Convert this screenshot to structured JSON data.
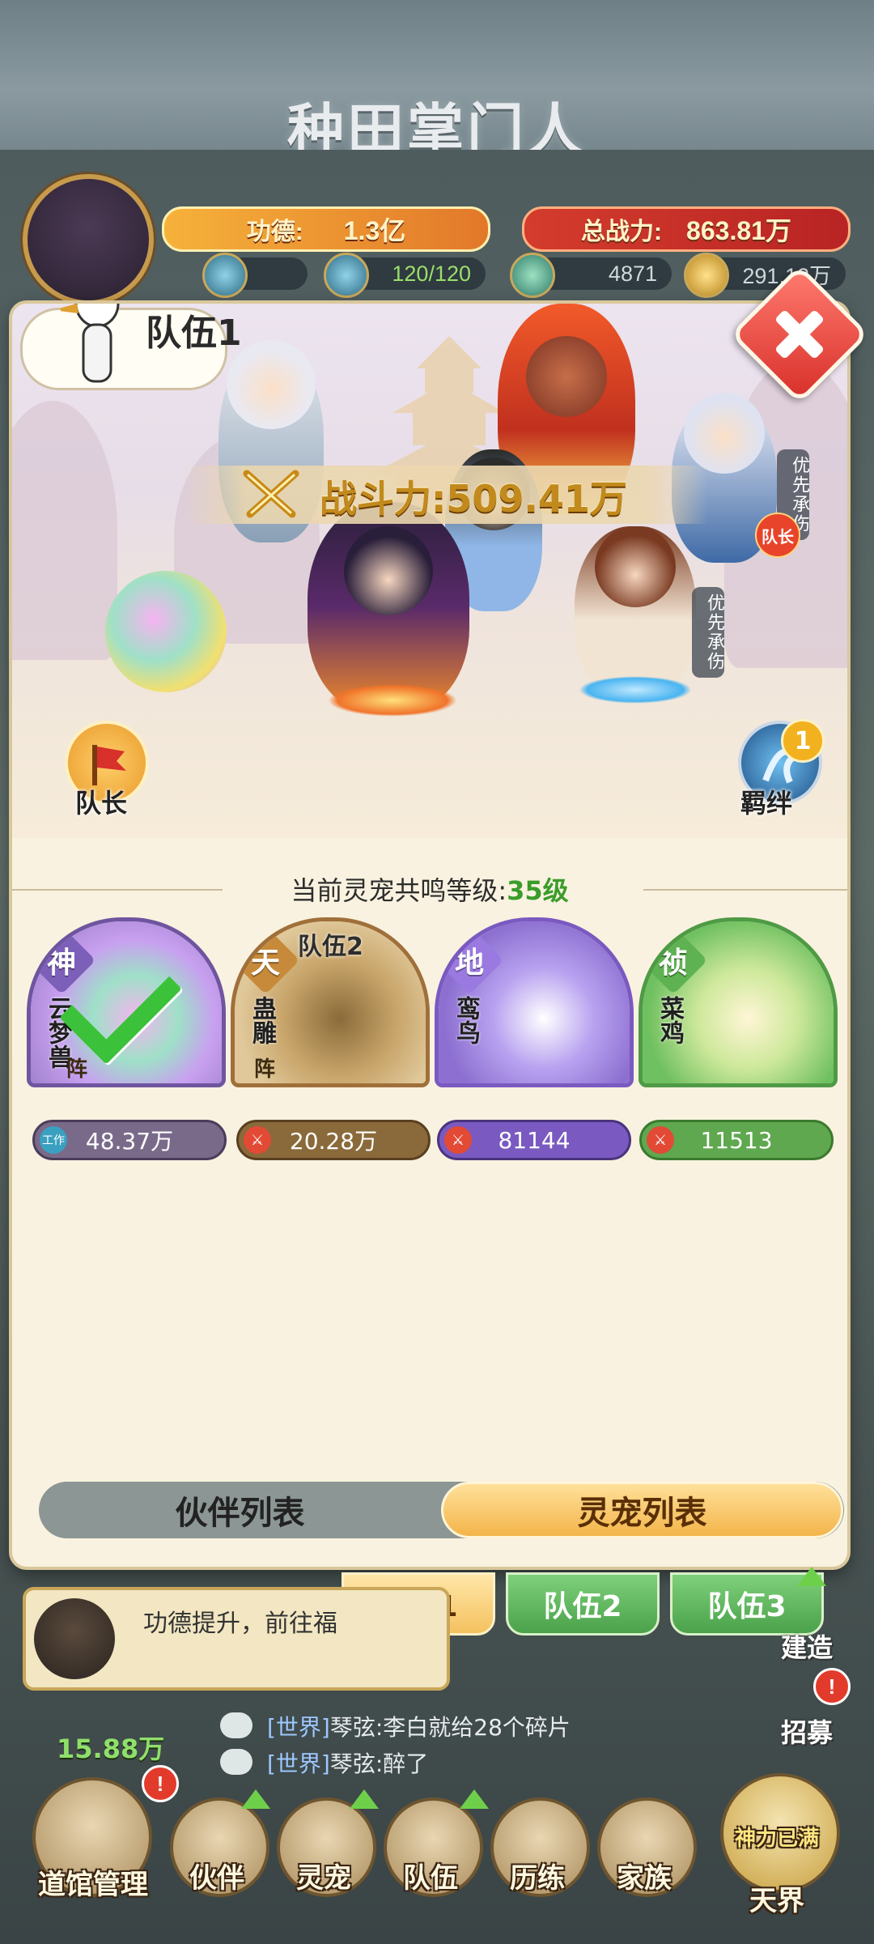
{
  "game": {
    "title": "种田掌门人",
    "merit_label": "功德:",
    "merit_value": "1.3亿",
    "total_power_label": "总战力:",
    "total_power_value": "863.81万",
    "stamina": "120/120",
    "resource_a": "4871",
    "resource_b": "291.12万"
  },
  "dialog": {
    "team_title": "队伍1",
    "leader_button": "队长",
    "bond_button": "羁绊",
    "bond_badge": "1",
    "power_label": "战斗力:",
    "power_value": "509.41万",
    "tag_priority_1": "优先承伤",
    "tag_priority_2": "优先承伤",
    "leader_badge": "队长",
    "resonance_label": "当前灵宠共鸣等级:",
    "resonance_level": "35级"
  },
  "pets": [
    {
      "rank": "神",
      "name": "云梦兽",
      "team": "",
      "formation": "阵",
      "status": "工作",
      "power": "48.37万",
      "selected": true,
      "color": "#8a6fb8"
    },
    {
      "rank": "天",
      "name": "蛊雕",
      "team": "队伍2",
      "formation": "阵",
      "power": "20.28万",
      "selected": false,
      "color": "#c78a3a"
    },
    {
      "rank": "地",
      "name": "鸾鸟",
      "team": "",
      "formation": "",
      "power": "81144",
      "selected": false,
      "color": "#8c6fd0"
    },
    {
      "rank": "祯",
      "name": "菜鸡",
      "team": "",
      "formation": "",
      "power": "11513",
      "selected": false,
      "color": "#5fb252"
    }
  ],
  "list_tabs": {
    "partner": "伙伴列表",
    "pet": "灵宠列表",
    "active": "pet"
  },
  "team_tabs": [
    "队伍1",
    "队伍2",
    "队伍3"
  ],
  "notice": {
    "text": "功德提升，前往福"
  },
  "chat": [
    {
      "channel": "[世界]",
      "message": "琴弦:李白就给28个碎片"
    },
    {
      "channel": "[世界]",
      "message": "琴弦:醉了"
    }
  ],
  "gold_value": "15.88万",
  "side_buttons": {
    "build": "建造",
    "recruit": "招募"
  },
  "nav": [
    {
      "label": "道馆管理"
    },
    {
      "label": "伙伴"
    },
    {
      "label": "灵宠"
    },
    {
      "label": "队伍"
    },
    {
      "label": "历练"
    },
    {
      "label": "家族"
    },
    {
      "label": "天界",
      "sub": "神力已满"
    }
  ]
}
